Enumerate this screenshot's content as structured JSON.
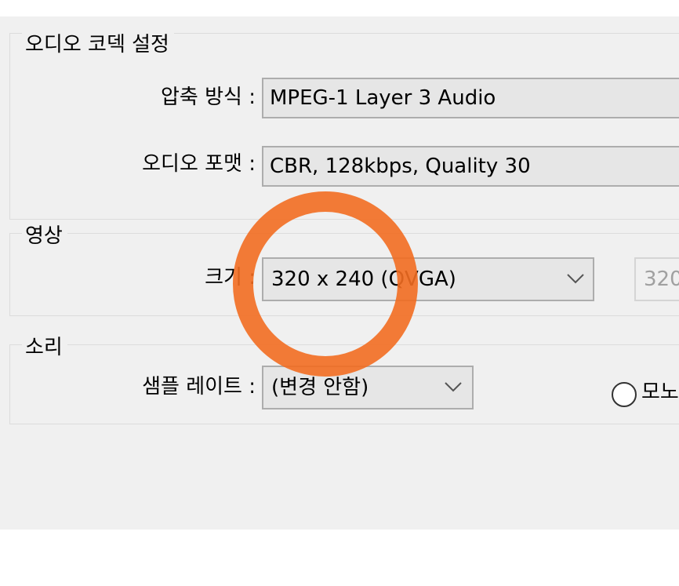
{
  "audio_codec": {
    "legend": "오디오 코덱 설정",
    "compression_label": "압축 방식 :",
    "compression_value": "MPEG-1 Layer 3 Audio",
    "format_label": "오디오 포맷 :",
    "format_value": "CBR, 128kbps, Quality 30"
  },
  "video": {
    "legend": "영상",
    "size_label": "크기 :",
    "size_value": "320 x 240 (QVGA)",
    "width_value": "320"
  },
  "sound": {
    "legend": "소리",
    "sample_rate_label": "샘플 레이트 :",
    "sample_rate_value": "(변경 안함)",
    "mono_label": "모노"
  },
  "colors": {
    "highlight": "#f26d21"
  },
  "icons": {
    "dropdown": "chevron-down-icon",
    "annotation": "highlight-circle"
  }
}
